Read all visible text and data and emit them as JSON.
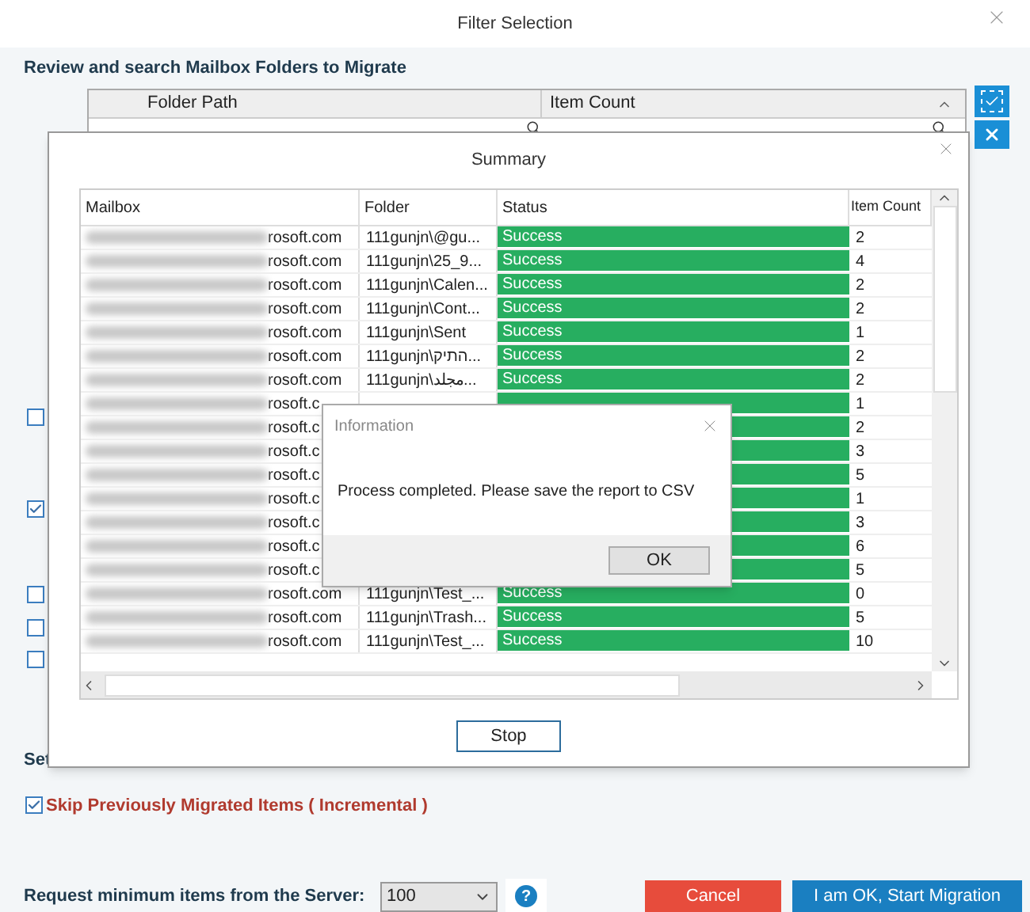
{
  "window": {
    "title": "Filter Selection"
  },
  "heading": "Review and search Mailbox Folders to Migrate",
  "folder_grid": {
    "columns": [
      "Folder Path",
      "Item Count"
    ]
  },
  "options": [
    {
      "checked": false
    },
    {
      "checked": true
    },
    {
      "checked": false
    },
    {
      "checked": false
    },
    {
      "checked": false
    }
  ],
  "settings_label": "Set",
  "incremental": {
    "label": "Skip Previously Migrated Items ( Incremental )",
    "checked": true
  },
  "min_items": {
    "label": "Request minimum items from the Server:",
    "value": "100",
    "help": "?"
  },
  "buttons": [
    {
      "label": "Cancel",
      "kind": "cancel"
    },
    {
      "label": "I am OK, Start Migration",
      "kind": "primary"
    }
  ],
  "summary": {
    "title": "Summary",
    "columns": [
      "Mailbox",
      "Folder",
      "Status",
      "Item Count"
    ],
    "rows": [
      {
        "mailbox": "rosoft.com",
        "folder": "111gunjn\\@gu...",
        "status": "Success",
        "color": "#27ae60",
        "count": "2"
      },
      {
        "mailbox": "rosoft.com",
        "folder": "111gunjn\\25_9...",
        "status": "Success",
        "color": "#27ae60",
        "count": "4"
      },
      {
        "mailbox": "rosoft.com",
        "folder": "111gunjn\\Calen...",
        "status": "Success",
        "color": "#27ae60",
        "count": "2"
      },
      {
        "mailbox": "rosoft.com",
        "folder": "111gunjn\\Cont...",
        "status": "Success",
        "color": "#27ae60",
        "count": "2"
      },
      {
        "mailbox": "rosoft.com",
        "folder": "111gunjn\\Sent",
        "status": "Success",
        "color": "#27ae60",
        "count": "1"
      },
      {
        "mailbox": "rosoft.com",
        "folder": "111gunjn\\התיק...",
        "status": "Success",
        "color": "#27ae60",
        "count": "2"
      },
      {
        "mailbox": "rosoft.com",
        "folder": "111gunjn\\مجلد...",
        "status": "Success",
        "color": "#27ae60",
        "count": "2"
      },
      {
        "mailbox": "rosoft.c",
        "color": "#27ae60",
        "count": "1"
      },
      {
        "mailbox": "rosoft.c",
        "color": "#27ae60",
        "count": "2"
      },
      {
        "mailbox": "rosoft.c",
        "color": "#27ae60",
        "count": "3"
      },
      {
        "mailbox": "rosoft.c",
        "color": "#27ae60",
        "count": "5"
      },
      {
        "mailbox": "rosoft.c",
        "color": "#27ae60",
        "count": "1"
      },
      {
        "mailbox": "rosoft.c",
        "color": "#27ae60",
        "count": "3"
      },
      {
        "mailbox": "rosoft.c",
        "color": "#27ae60",
        "count": "6"
      },
      {
        "mailbox": "rosoft.c",
        "color": "#27ae60",
        "count": "5"
      },
      {
        "mailbox": "rosoft.com",
        "folder": "111gunjn\\Test_...",
        "status": "Success",
        "color": "#27ae60",
        "count": "0"
      },
      {
        "mailbox": "rosoft.com",
        "folder": "111gunjn\\Trash...",
        "status": "Success",
        "color": "#27ae60",
        "count": "5"
      },
      {
        "mailbox": "rosoft.com",
        "folder": "111gunjn\\Test_...",
        "status": "Success",
        "color": "#27ae60",
        "count": "10"
      }
    ],
    "stop": "Stop"
  },
  "info": {
    "title": "Information",
    "message": "Process completed. Please save the report to CSV",
    "ok": "OK"
  }
}
